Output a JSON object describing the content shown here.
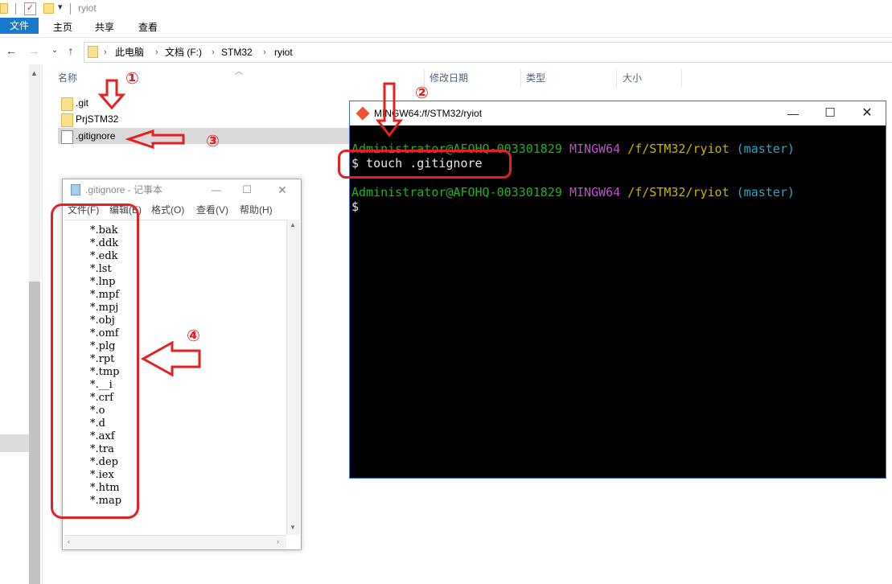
{
  "explorer": {
    "window_title": "ryiot",
    "ribbon_tabs": [
      "文件",
      "主页",
      "共享",
      "查看"
    ],
    "breadcrumb": [
      "此电脑",
      "文档 (F:)",
      "STM32",
      "ryiot"
    ],
    "columns": [
      "名称",
      "修改日期",
      "类型",
      "大小"
    ],
    "files": [
      {
        "name": ".git",
        "icon": "folder-icon",
        "date": "",
        "type": ""
      },
      {
        "name": "PrjSTM32",
        "icon": "folder-icon",
        "date": "",
        "type": ""
      },
      {
        "name": ".gitignore",
        "icon": "document-icon",
        "date": "",
        "type": ""
      }
    ]
  },
  "notepad": {
    "title": ".gitignore - 记事本",
    "menu": [
      "文件(F)",
      "编辑(E)",
      "格式(O)",
      "查看(V)",
      "帮助(H)"
    ],
    "lines": [
      "*.bak",
      "*.ddk",
      "*.edk",
      "*.lst",
      "*.lnp",
      "*.mpf",
      "*.mpj",
      "*.obj",
      "*.omf",
      "*.plg",
      "*.rpt",
      "*.tmp",
      "*.__i",
      "*.crf",
      "*.o",
      "*.d",
      "*.axf",
      "*.tra",
      "*.dep",
      "*.iex",
      "*.htm",
      "*.map"
    ]
  },
  "terminal": {
    "title": "MINGW64:/f/STM32/ryiot",
    "prompt_user": "Administrator@AFOHQ-003301829",
    "prompt_env": "MINGW64",
    "prompt_path": "/f/STM32/ryiot",
    "prompt_branch": "(master)",
    "command": "$ touch .gitignore",
    "prompt_symbol": "$"
  },
  "annotations": [
    "①",
    "②",
    "③",
    "④"
  ],
  "colors": {
    "annotation": "#e62020",
    "ribbon_file_tab": "#1979ca",
    "terminal_bg": "#000000"
  }
}
